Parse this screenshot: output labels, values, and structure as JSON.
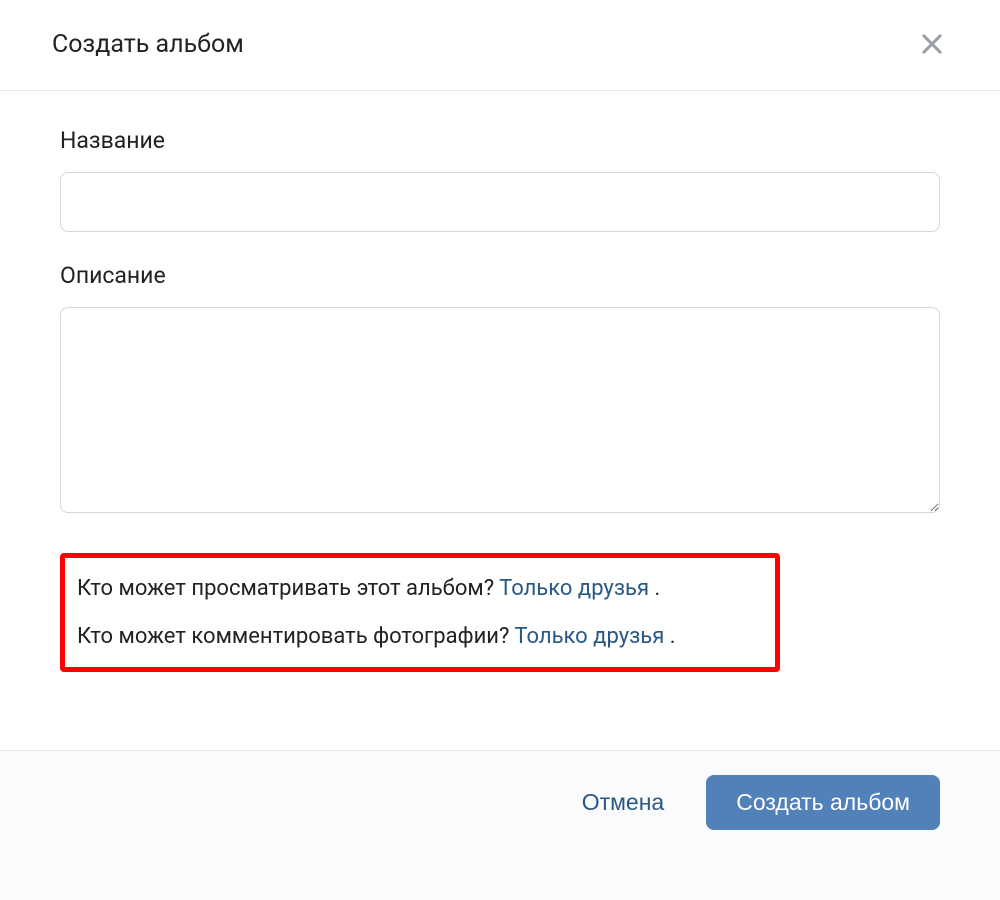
{
  "dialog": {
    "title": "Создать альбом",
    "close_icon": "close"
  },
  "fields": {
    "name_label": "Название",
    "name_value": "",
    "description_label": "Описание",
    "description_value": ""
  },
  "privacy": {
    "view_question": "Кто может просматривать этот альбом?",
    "view_value": "Только друзья",
    "comment_question": "Кто может комментировать фотографии?",
    "comment_value": "Только друзья",
    "period": "."
  },
  "footer": {
    "cancel_label": "Отмена",
    "submit_label": "Создать альбом"
  },
  "colors": {
    "link": "#2a5885",
    "primary_button": "#5181b8",
    "highlight_border": "#ff0000"
  }
}
